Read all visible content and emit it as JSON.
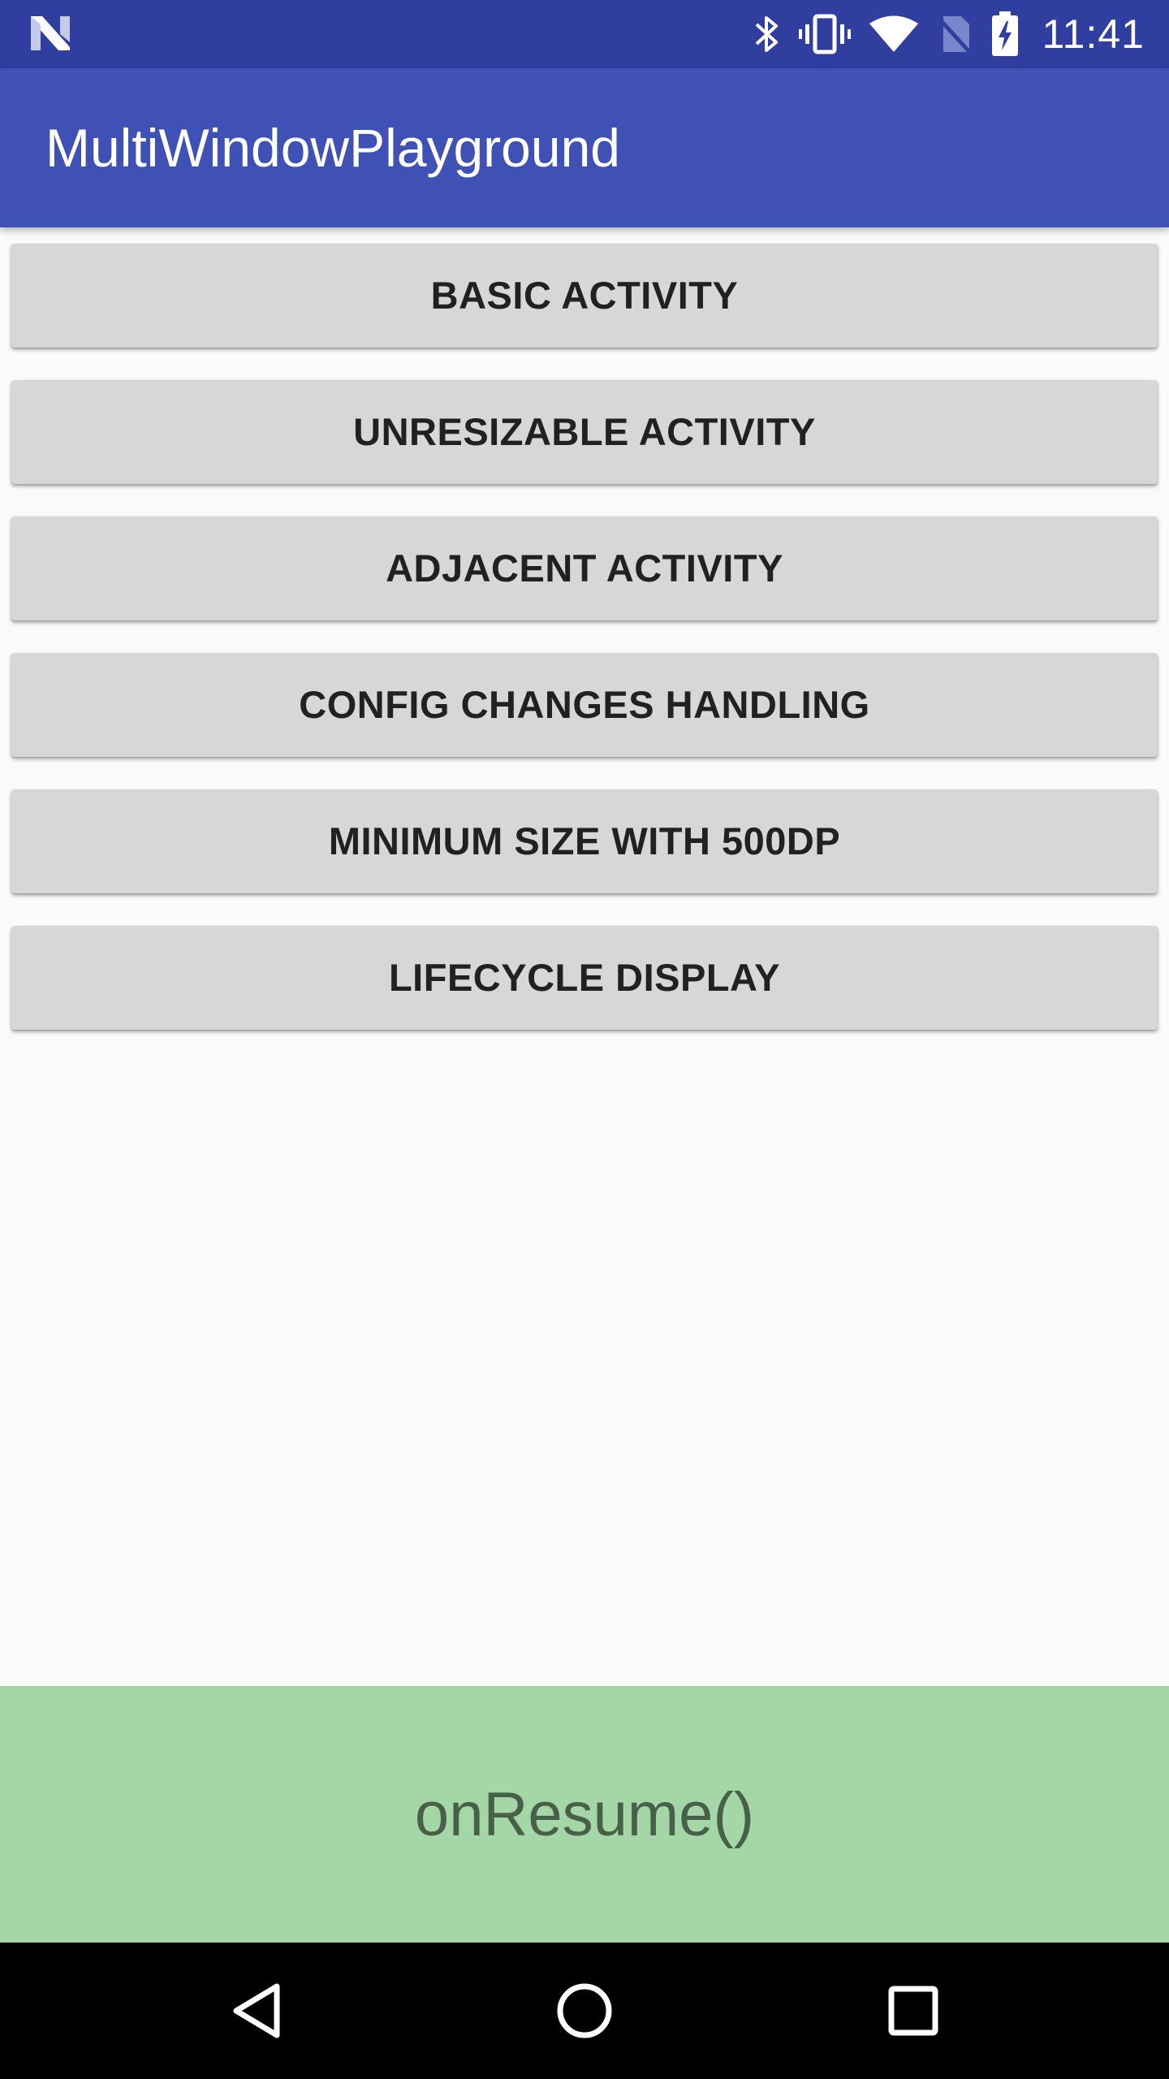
{
  "status_bar": {
    "time": "11:41",
    "icons": [
      "notification-n-icon",
      "bluetooth-icon",
      "vibrate-icon",
      "wifi-icon",
      "no-sim-icon",
      "battery-charging-icon"
    ]
  },
  "app_bar": {
    "title": "MultiWindowPlayground"
  },
  "buttons": [
    {
      "label": "BASIC ACTIVITY"
    },
    {
      "label": "UNRESIZABLE ACTIVITY"
    },
    {
      "label": "ADJACENT ACTIVITY"
    },
    {
      "label": "CONFIG CHANGES HANDLING"
    },
    {
      "label": "MINIMUM SIZE WITH 500DP"
    },
    {
      "label": "LIFECYCLE DISPLAY"
    }
  ],
  "lifecycle": {
    "state": "onResume()"
  },
  "nav_bar": {
    "icons": [
      "back-icon",
      "home-icon",
      "recents-icon"
    ]
  },
  "colors": {
    "status_bar": "#303f9f",
    "app_bar": "#3f51b5",
    "background": "#fafafa",
    "button": "#d6d7d7",
    "lifecycle_panel": "#a5d6a7",
    "lifecycle_text": "#466147",
    "nav_bar": "#000000"
  }
}
